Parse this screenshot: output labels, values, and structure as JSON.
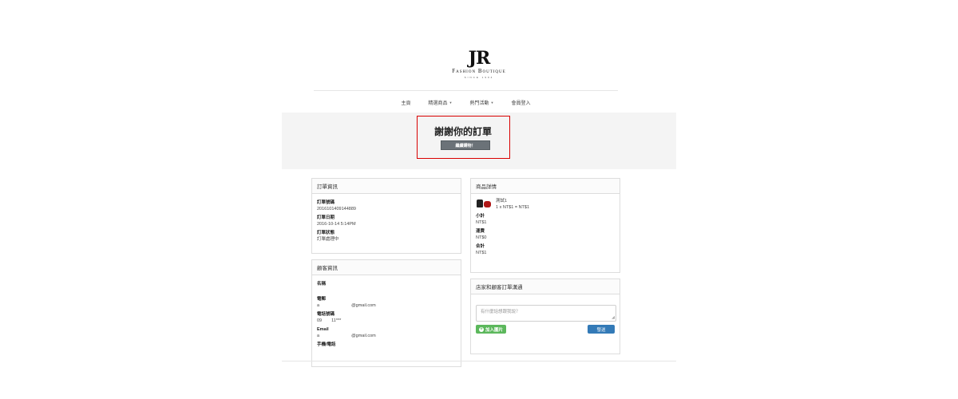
{
  "logo": {
    "mark": "JR",
    "name": "Fashion Boutique",
    "since": "SINCE 1994"
  },
  "nav": [
    {
      "label": "主頁",
      "dropdown": false
    },
    {
      "label": "精選商品",
      "dropdown": true
    },
    {
      "label": "熱門活動",
      "dropdown": true
    },
    {
      "label": "會員登入",
      "dropdown": false
    }
  ],
  "hero": {
    "title": "謝謝你的訂單",
    "button": "繼續購物！"
  },
  "order_info": {
    "title": "訂單資訊",
    "fields": [
      {
        "label": "訂單號碼",
        "value": "20161014091448​89"
      },
      {
        "label": "訂單日期",
        "value": "2016-10-14 5:14PM"
      },
      {
        "label": "訂單狀態",
        "value": "訂單處理中"
      }
    ]
  },
  "buyer_info": {
    "title": "顧客資訊",
    "name_label": "名稱",
    "email_label": "電郵",
    "email_prefix": "a",
    "email_domain": "@gmail.com",
    "phone_label": "電話號碼",
    "phone_prefix": "09",
    "phone_suffix": "11***",
    "email2_label": "Email",
    "email2_prefix": "a",
    "email2_domain": "@gmail.com",
    "mobile_label": "手機/電話"
  },
  "product": {
    "title": "商品詳情",
    "item_name": "測試1",
    "item_line": "1 x NT$1 = NT$1",
    "subtotal_label": "小計",
    "subtotal": "NT$1",
    "shipping_label": "運費",
    "shipping": "NT$0",
    "total_label": "合計",
    "total": "NT$1"
  },
  "message": {
    "title": "店家和顧客訂單溝通",
    "placeholder": "有什麼話想跟我說？",
    "add_image": "加入圖片",
    "send": "發送"
  }
}
